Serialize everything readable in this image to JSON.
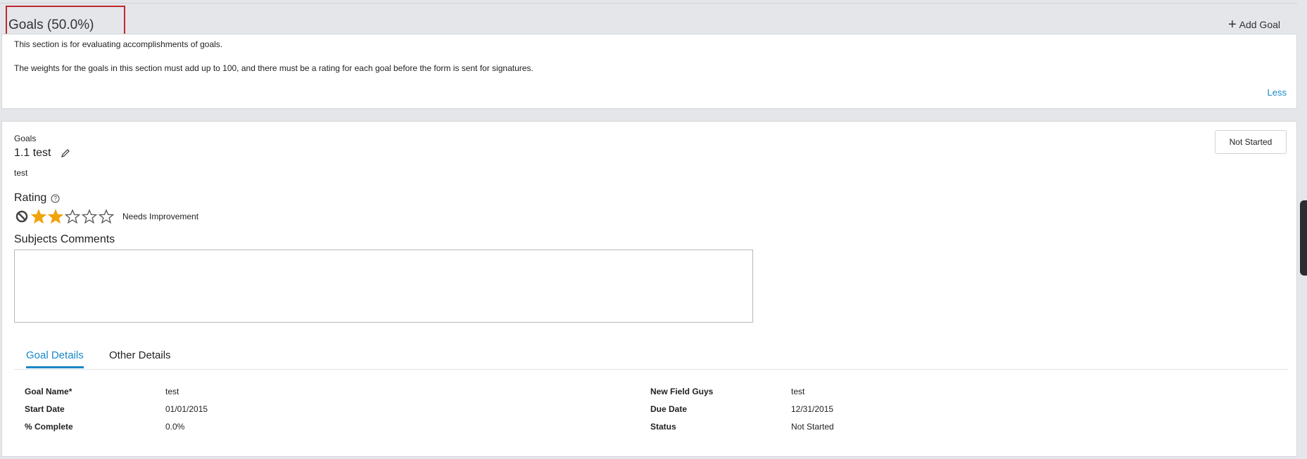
{
  "section": {
    "title": "Goals (50.0%)",
    "add_goal_label": "Add Goal",
    "intro_line1": "This section is for evaluating accomplishments of goals.",
    "intro_line2": "The weights for the goals in this section must add up to 100, and there must be a rating for each goal before the form is sent for signatures.",
    "less_label": "Less"
  },
  "goal": {
    "category_label": "Goals",
    "title": "1.1 test",
    "description": "test",
    "status_button": "Not Started",
    "rating_label": "Rating",
    "rating_value": 2,
    "rating_max": 5,
    "rating_text": "Needs Improvement",
    "comments_label": "Subjects Comments",
    "comments_value": ""
  },
  "tabs": [
    {
      "label": "Goal Details",
      "active": true
    },
    {
      "label": "Other Details",
      "active": false
    }
  ],
  "details": {
    "left": [
      {
        "label": "Goal Name*",
        "value": "test"
      },
      {
        "label": "Start Date",
        "value": "01/01/2015"
      },
      {
        "label": "% Complete",
        "value": "0.0%"
      }
    ],
    "right": [
      {
        "label": "New Field Guys",
        "value": "test"
      },
      {
        "label": "Due Date",
        "value": "12/31/2015"
      },
      {
        "label": "Status",
        "value": "Not Started"
      }
    ]
  },
  "colors": {
    "accent": "#1a87c9",
    "star_filled": "#f0a30a",
    "highlight_box": "#c0292b"
  }
}
